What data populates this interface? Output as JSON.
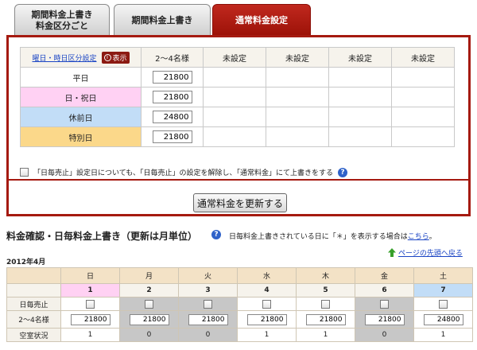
{
  "tabs": [
    {
      "label_line1": "期間料金上書き",
      "label_line2": "料金区分ごと"
    },
    {
      "label": "期間料金上書き"
    },
    {
      "label": "通常料金設定"
    }
  ],
  "rate_table": {
    "config_link": "曜日・時日区分設定",
    "show_badge": "表示",
    "columns": [
      "2～4名様",
      "未設定",
      "未設定",
      "未設定",
      "未設定"
    ],
    "rows": [
      {
        "label": "平日",
        "value": "21800"
      },
      {
        "label": "日・祝日",
        "value": "21800"
      },
      {
        "label": "休前日",
        "value": "24800"
      },
      {
        "label": "特別日",
        "value": "21800"
      }
    ]
  },
  "override_note": "「日毎売止」設定日についても、「日毎売止」の設定を解除し、「通常料金」にて上書きをする",
  "update_button": "通常料金を更新する",
  "section": {
    "title": "料金確認・日毎料金上書き（更新は月単位）",
    "note_prefix": "日毎料金上書きされている日に「＊」を表示する場合は",
    "note_link": "こちら",
    "note_suffix": "。",
    "top_link": "ページの先頭へ戻る",
    "year_month": "2012年4月"
  },
  "calendar": {
    "weekdays": [
      "日",
      "月",
      "火",
      "水",
      "木",
      "金",
      "土"
    ],
    "dates": [
      "1",
      "2",
      "3",
      "4",
      "5",
      "6",
      "7"
    ],
    "row_labels": {
      "stop": "日毎売止",
      "rate": "2～4名様",
      "vacancy": "空室状況"
    },
    "rates": [
      "21800",
      "21800",
      "21800",
      "21800",
      "21800",
      "21800",
      "24800"
    ],
    "vacancy": [
      "1",
      "0",
      "0",
      "1",
      "1",
      "0",
      "1"
    ]
  },
  "colors": {
    "accent": "#a51a10",
    "sunday": "#ffd1f3",
    "saturday": "#c2ddf7",
    "special": "#fbd88a"
  }
}
